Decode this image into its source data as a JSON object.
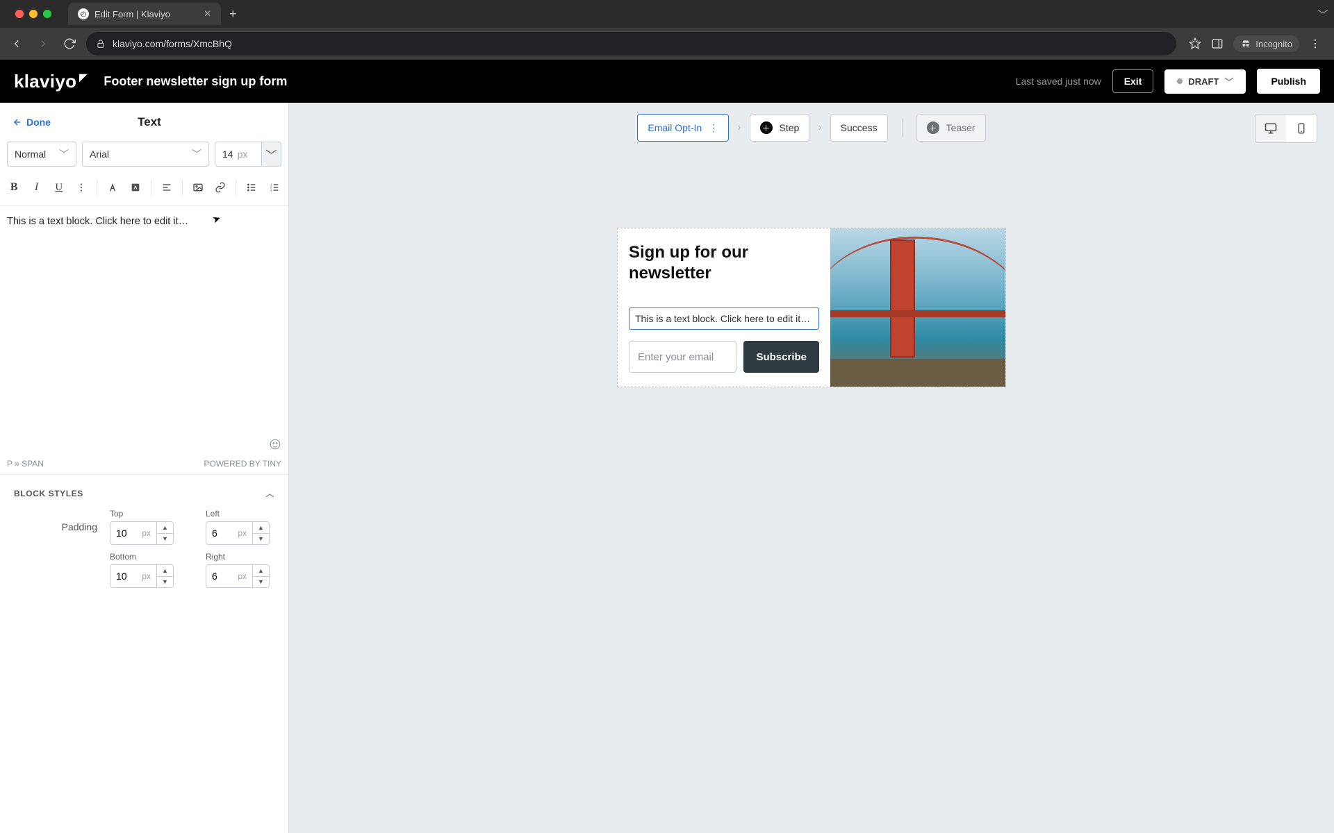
{
  "browser": {
    "tab_title": "Edit Form | Klaviyo",
    "url": "klaviyo.com/forms/XmcBhQ",
    "incognito_label": "Incognito"
  },
  "header": {
    "logo_text": "klaviyo",
    "form_title": "Footer newsletter sign up form",
    "saved_text": "Last saved just now",
    "exit_label": "Exit",
    "status_label": "DRAFT",
    "publish_label": "Publish"
  },
  "panel": {
    "done_label": "Done",
    "title": "Text",
    "style_select": "Normal",
    "font_select": "Arial",
    "size_value": "14",
    "size_unit": "px",
    "editor_text": "This is a text block. Click here to edit it…",
    "path_text": "P » SPAN",
    "powered_text": "POWERED BY TINY",
    "block_styles_label": "BLOCK STYLES",
    "padding_label": "Padding",
    "padding": {
      "top_label": "Top",
      "top_value": "10",
      "left_label": "Left",
      "left_value": "6",
      "bottom_label": "Bottom",
      "bottom_value": "10",
      "right_label": "Right",
      "right_value": "6",
      "unit": "px"
    }
  },
  "canvas": {
    "steps": {
      "email_opt_in": "Email Opt-In",
      "step_label": "Step",
      "success_label": "Success",
      "teaser_label": "Teaser"
    },
    "preview": {
      "heading": "Sign up for our newsletter",
      "text_block": "This is a text block. Click here to edit it…",
      "email_placeholder": "Enter your email",
      "subscribe_label": "Subscribe"
    }
  }
}
